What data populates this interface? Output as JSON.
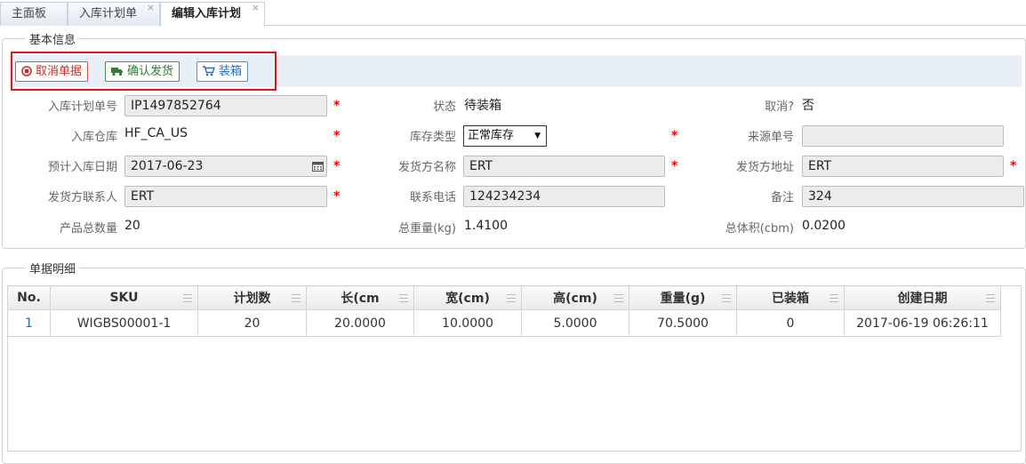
{
  "tabs": [
    {
      "label": "主面板"
    },
    {
      "label": "入库计划单",
      "close": "×"
    },
    {
      "label": "编辑入库计划",
      "close": "×"
    }
  ],
  "basic": {
    "legend": "基本信息",
    "buttons": {
      "cancel": "取消单据",
      "confirm": "确认发货",
      "pack": "装箱"
    },
    "fields": {
      "plan_no_label": "入库计划单号",
      "plan_no": "IP1497852764",
      "status_label": "状态",
      "status": "待装箱",
      "cancelled_label": "取消?",
      "cancelled": "否",
      "warehouse_label": "入库仓库",
      "warehouse": "HF_CA_US",
      "stock_type_label": "库存类型",
      "stock_type": "正常库存",
      "source_no_label": "来源单号",
      "source_no": "",
      "eta_label": "预计入库日期",
      "eta": "2017-06-23",
      "shipper_name_label": "发货方名称",
      "shipper_name": "ERT",
      "shipper_addr_label": "发货方地址",
      "shipper_addr": "ERT",
      "contact_label": "发货方联系人",
      "contact": "ERT",
      "phone_label": "联系电话",
      "phone": "124234234",
      "remark_label": "备注",
      "remark": "324",
      "qty_label": "产品总数量",
      "qty": "20",
      "weight_label": "总重量(kg)",
      "weight": "1.4100",
      "volume_label": "总体积(cbm)",
      "volume": "0.0200"
    },
    "required_mark": "*"
  },
  "detail": {
    "legend": "单据明细",
    "columns": [
      "No.",
      "SKU",
      "计划数",
      "长(cm",
      "宽(cm)",
      "高(cm)",
      "重量(g)",
      "已装箱",
      "创建日期"
    ],
    "rows": [
      [
        "1",
        "WIGBS00001-1",
        "20",
        "20.0000",
        "10.0000",
        "5.0000",
        "70.5000",
        "0",
        "2017-06-19 06:26:11"
      ]
    ]
  },
  "colors": {
    "accent_red": "#e0161b",
    "toolbar_bg": "#e9eff7"
  }
}
